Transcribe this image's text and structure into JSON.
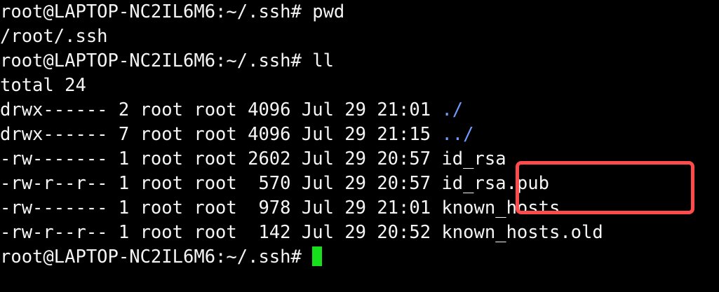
{
  "terminal": {
    "lines": [
      {
        "text": "root@LAPTOP-NC2IL6M6:~/.ssh# pwd"
      },
      {
        "text": "/root/.ssh"
      },
      {
        "text": "root@LAPTOP-NC2IL6M6:~/.ssh# ll"
      },
      {
        "text": "total 24"
      },
      {
        "prefix": "drwx------ 2 root root 4096 Jul 29 21:01 ",
        "name": "./"
      },
      {
        "prefix": "drwx------ 7 root root 4096 Jul 29 21:15 ",
        "name": "../"
      },
      {
        "prefix": "-rw------- 1 root root 2602 Jul 29 20:57 ",
        "name": "id_rsa"
      },
      {
        "prefix": "-rw-r--r-- 1 root root  570 Jul 29 20:57 ",
        "name": "id_rsa.pub"
      },
      {
        "prefix": "-rw------- 1 root root  978 Jul 29 21:01 ",
        "name": "known_hosts"
      },
      {
        "prefix": "-rw-r--r-- 1 root root  142 Jul 29 20:52 ",
        "name": "known_hosts.old"
      },
      {
        "text": "root@LAPTOP-NC2IL6M6:~/.ssh# "
      }
    ]
  },
  "colors": {
    "background": "#000000",
    "text": "#f5f5f5",
    "directory": "#6f9cff",
    "cursor": "#16e01b",
    "highlight_box": "#ff4b4b"
  }
}
